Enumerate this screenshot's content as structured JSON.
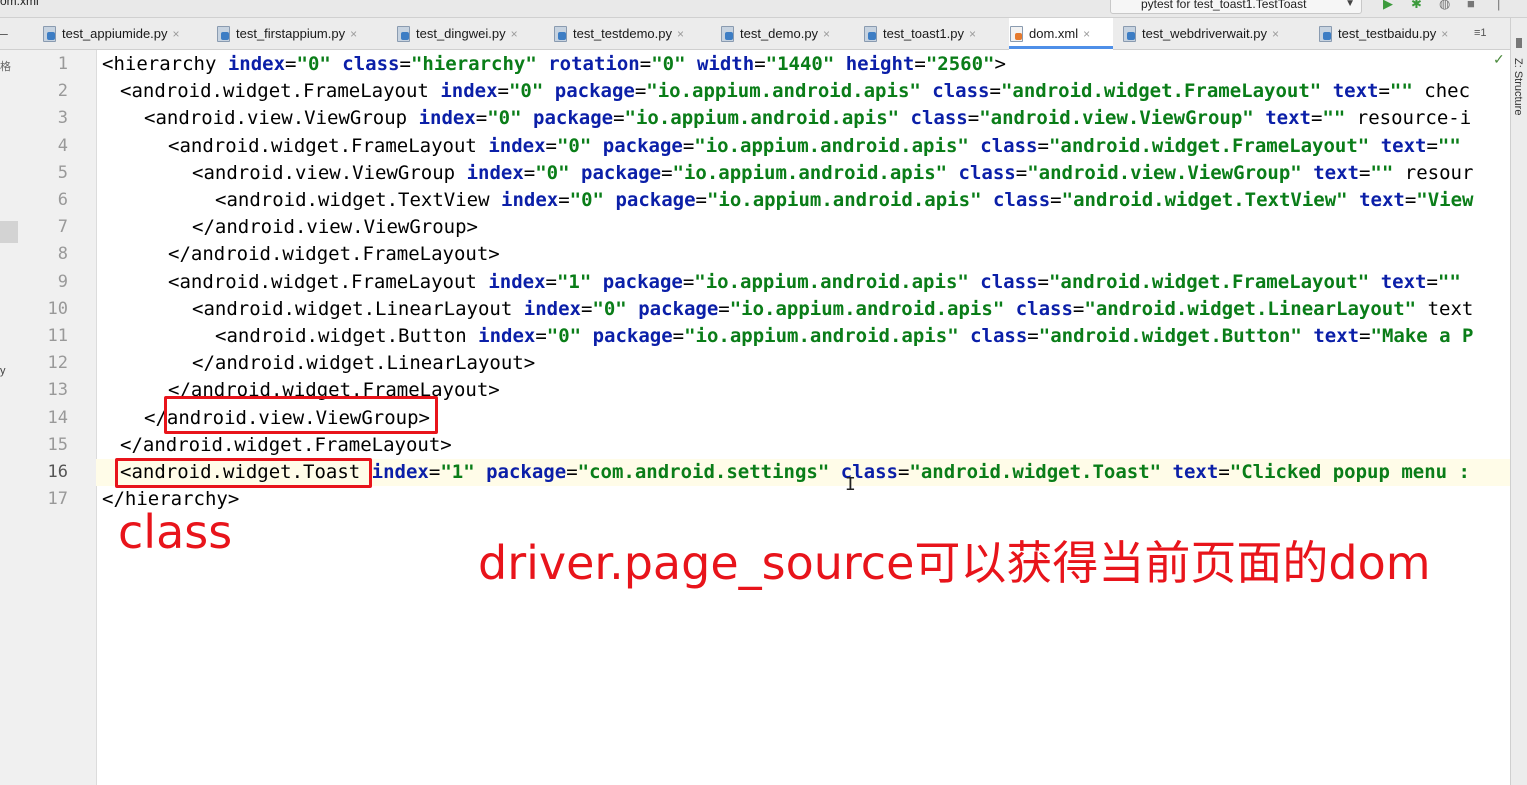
{
  "window": {
    "file_name": "om.xml",
    "run_config": "pytest for test_toast1.TestToast"
  },
  "tabs": [
    {
      "label": "test_appiumide.py",
      "type": "py",
      "active": false
    },
    {
      "label": "test_firstappium.py",
      "type": "py",
      "active": false
    },
    {
      "label": "test_dingwei.py",
      "type": "py",
      "active": false
    },
    {
      "label": "test_testdemo.py",
      "type": "py",
      "active": false
    },
    {
      "label": "test_demo.py",
      "type": "py",
      "active": false
    },
    {
      "label": "test_toast1.py",
      "type": "py",
      "active": false
    },
    {
      "label": "dom.xml",
      "type": "xml",
      "active": true
    },
    {
      "label": "test_webdriverwait.py",
      "type": "py",
      "active": false
    },
    {
      "label": "test_testbaidu.py",
      "type": "py",
      "active": false
    }
  ],
  "tab_overflow": "≡1",
  "left_strip": {
    "text1": "格",
    "text2": "y"
  },
  "right_strip": {
    "structure_label": "Z: Structure"
  },
  "current_line": 16,
  "editor_lines": [
    {
      "n": "1",
      "indent": 0,
      "text": "<hierarchy index=\"0\" class=\"hierarchy\" rotation=\"0\" width=\"1440\" height=\"2560\">"
    },
    {
      "n": "2",
      "indent": 1,
      "text": "<android.widget.FrameLayout index=\"0\" package=\"io.appium.android.apis\" class=\"android.widget.FrameLayout\" text=\"\" chec"
    },
    {
      "n": "3",
      "indent": 2,
      "text": "<android.view.ViewGroup index=\"0\" package=\"io.appium.android.apis\" class=\"android.view.ViewGroup\" text=\"\" resource-i"
    },
    {
      "n": "4",
      "indent": 3,
      "text": "<android.widget.FrameLayout index=\"0\" package=\"io.appium.android.apis\" class=\"android.widget.FrameLayout\" text=\"\""
    },
    {
      "n": "5",
      "indent": 4,
      "text": "<android.view.ViewGroup index=\"0\" package=\"io.appium.android.apis\" class=\"android.view.ViewGroup\" text=\"\" resour"
    },
    {
      "n": "6",
      "indent": 5,
      "text": "<android.widget.TextView index=\"0\" package=\"io.appium.android.apis\" class=\"android.widget.TextView\" text=\"View"
    },
    {
      "n": "7",
      "indent": 4,
      "text": "</android.view.ViewGroup>"
    },
    {
      "n": "8",
      "indent": 3,
      "text": "</android.widget.FrameLayout>"
    },
    {
      "n": "9",
      "indent": 3,
      "text": "<android.widget.FrameLayout index=\"1\" package=\"io.appium.android.apis\" class=\"android.widget.FrameLayout\" text=\"\""
    },
    {
      "n": "10",
      "indent": 4,
      "text": "<android.widget.LinearLayout index=\"0\" package=\"io.appium.android.apis\" class=\"android.widget.LinearLayout\" text"
    },
    {
      "n": "11",
      "indent": 5,
      "text": "<android.widget.Button index=\"0\" package=\"io.appium.android.apis\" class=\"android.widget.Button\" text=\"Make a P"
    },
    {
      "n": "12",
      "indent": 4,
      "text": "</android.widget.LinearLayout>"
    },
    {
      "n": "13",
      "indent": 3,
      "text": "</android.widget.FrameLayout>"
    },
    {
      "n": "14",
      "indent": 2,
      "text": "</android.view.ViewGroup>"
    },
    {
      "n": "15",
      "indent": 1,
      "text": "</android.widget.FrameLayout>"
    },
    {
      "n": "16",
      "indent": 1,
      "text": "<android.widget.Toast index=\"1\" package=\"com.android.settings\" class=\"android.widget.Toast\" text=\"Clicked popup menu :"
    },
    {
      "n": "17",
      "indent": 0,
      "text": "</hierarchy>"
    }
  ],
  "annotations": {
    "class_label": "class",
    "note": "driver.page_source可以获得当前页面的dom"
  },
  "colors": {
    "attr": "#0b1fa8",
    "value": "#0a7d18",
    "annotation_red": "#e8141b",
    "active_tab_underline": "#4e8fe8"
  }
}
